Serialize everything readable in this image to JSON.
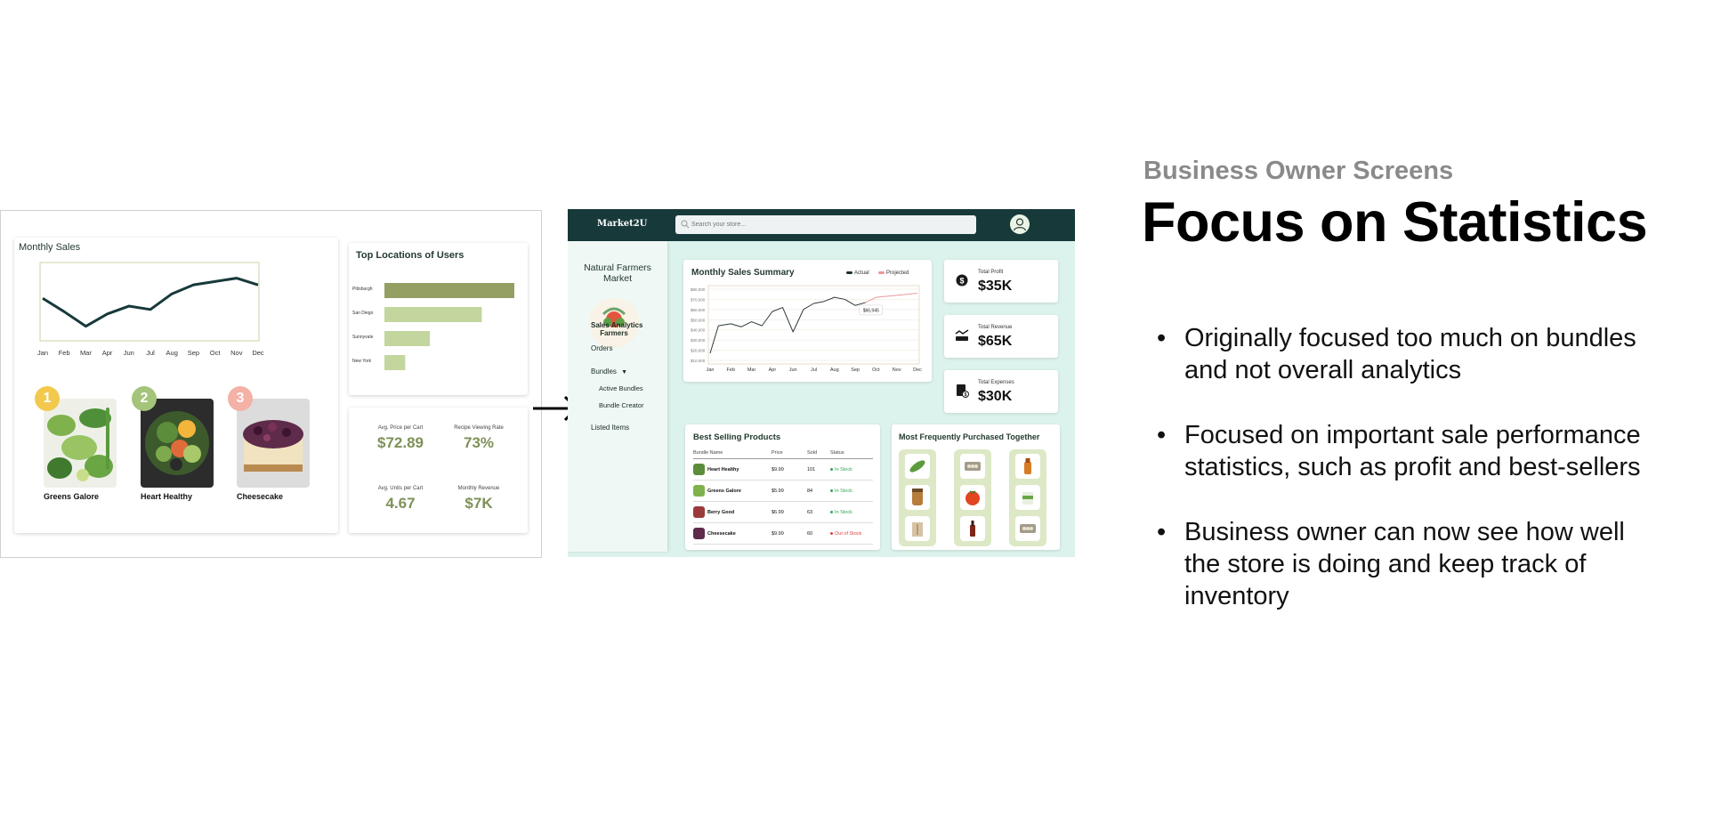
{
  "old_screen": {
    "monthly_sales_title": "Monthly Sales",
    "months": [
      "Jan",
      "Feb",
      "Mar",
      "Apr",
      "Jun",
      "Jul",
      "Aug",
      "Sep",
      "Oct",
      "Nov",
      "Dec"
    ],
    "top_products": [
      {
        "rank": "1",
        "name": "Greens Galore",
        "rank_color": "#f2c94c"
      },
      {
        "rank": "2",
        "name": "Heart Healthy",
        "rank_color": "#a3c47a"
      },
      {
        "rank": "3",
        "name": "Cheesecake",
        "rank_color": "#f4b1a5"
      }
    ],
    "locations_title": "Top Locations of Users",
    "locations": [
      "Pittsburgh",
      "San Diego",
      "Sunnyvale",
      "New York"
    ],
    "location_shares": [
      1.0,
      0.75,
      0.35,
      0.16
    ],
    "stats": [
      {
        "label": "Avg. Price per Cart",
        "value": "$72.89"
      },
      {
        "label": "Recipe Viewing Rate",
        "value": "73%"
      },
      {
        "label": "Avg. Units per Cart",
        "value": "4.67"
      },
      {
        "label": "Monthly Revenue",
        "value": "$7K"
      }
    ]
  },
  "new_screen": {
    "logo": "Market2U",
    "search_placeholder": "Search your store...",
    "store_name": "Natural Farmers Market",
    "store_logo_text": "Farmers",
    "nav": {
      "sales_analytics": "Sales Analytics",
      "orders": "Orders",
      "bundles": "Bundles",
      "active_bundles": "Active Bundles",
      "bundle_creator": "Bundle Creator",
      "listed_items": "Listed Items"
    },
    "monthly_summary_title": "Monthly Sales Summary",
    "legend_actual": "Actual",
    "legend_projected": "Projected",
    "y_ticks": [
      "$80,000",
      "$70,000",
      "$60,000",
      "$50,000",
      "$40,000",
      "$30,000",
      "$20,000",
      "$10,000"
    ],
    "x_ticks": [
      "Jan",
      "Feb",
      "Mar",
      "Apr",
      "Jun",
      "Jul",
      "Aug",
      "Sep",
      "Oct",
      "Nov",
      "Dec"
    ],
    "tooltip": "$66,945",
    "kpis": [
      {
        "label": "Total Profit",
        "value": "$35K"
      },
      {
        "label": "Total Revenue",
        "value": "$65K"
      },
      {
        "label": "Total Expenses",
        "value": "$30K"
      }
    ],
    "best_selling_title": "Best Selling Products",
    "best_selling_columns": [
      "Bundle Name",
      "Price",
      "Sold",
      "Status"
    ],
    "best_selling_rows": [
      {
        "name": "Heart Healthy",
        "price": "$9.99",
        "sold": "101",
        "status": "In Stock"
      },
      {
        "name": "Greens Galore",
        "price": "$5.99",
        "sold": "84",
        "status": "In Stock"
      },
      {
        "name": "Berry Good",
        "price": "$6.99",
        "sold": "63",
        "status": "In Stock"
      },
      {
        "name": "Cheesecake",
        "price": "$9.99",
        "sold": "60",
        "status": "Out of Stock"
      }
    ],
    "frequently_title": "Most Frequently Purchased Together"
  },
  "text": {
    "kicker": "Business Owner Screens",
    "headline": "Focus on Statistics",
    "bullets": [
      "Originally focused too much on bundles and not overall analytics",
      "Focused on important sale performance statistics, such as profit and best-sellers",
      "Business owner can now see how well the store is doing and keep track of inventory"
    ]
  },
  "chart_data": [
    {
      "type": "line",
      "title": "Monthly Sales",
      "categories": [
        "Jan",
        "Feb",
        "Mar",
        "Apr",
        "Jun",
        "Jul",
        "Aug",
        "Sep",
        "Oct",
        "Nov",
        "Dec"
      ],
      "series": [
        {
          "values": [
            0.76,
            0.52,
            0.26,
            0.48,
            0.62,
            0.56,
            0.84,
            1.0,
            1.06,
            1.12,
            1.0
          ]
        }
      ],
      "ylim": [
        0,
        1.4
      ]
    },
    {
      "type": "bar",
      "title": "Top Locations of Users",
      "categories": [
        "Pittsburgh",
        "San Diego",
        "Sunnyvale",
        "New York"
      ],
      "values": [
        1.0,
        0.75,
        0.35,
        0.16
      ]
    },
    {
      "type": "line",
      "title": "Monthly Sales Summary",
      "xlabel": "",
      "ylabel": "",
      "ylim": [
        10000,
        80000
      ],
      "categories": [
        "Jan",
        "Feb",
        "Mar",
        "Apr",
        "Jun",
        "Jul",
        "Aug",
        "Sep",
        "Oct",
        "Nov",
        "Dec"
      ],
      "series": [
        {
          "name": "Actual",
          "x": [
            0,
            0.4,
            1,
            1.5,
            2,
            2.5,
            3,
            3.5,
            4,
            4.5,
            5,
            5.5,
            6,
            6.5,
            7,
            7.5
          ],
          "values": [
            17000,
            44000,
            46000,
            43000,
            48000,
            44000,
            58000,
            62000,
            38000,
            60000,
            66000,
            68000,
            72000,
            70000,
            64000,
            66945
          ]
        },
        {
          "name": "Projected",
          "x": [
            7.5,
            8,
            9,
            10
          ],
          "values": [
            66945,
            72000,
            74000,
            76000
          ]
        }
      ],
      "colors": {
        "actual": "#2f3b37",
        "projected": "#e99a98"
      }
    }
  ]
}
